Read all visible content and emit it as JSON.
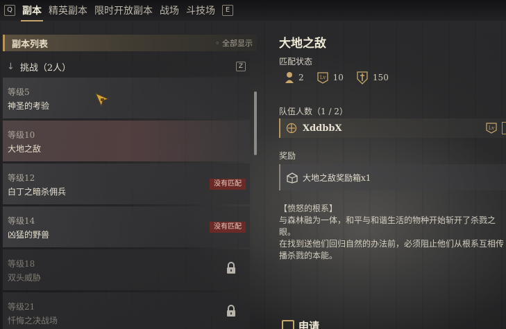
{
  "nav": {
    "left_key": "Q",
    "right_key": "E",
    "tabs": [
      {
        "label": "副本",
        "active": true
      },
      {
        "label": "精英副本",
        "active": false
      },
      {
        "label": "限时开放副本",
        "active": false
      },
      {
        "label": "战场",
        "active": false
      },
      {
        "label": "斗技场",
        "active": false
      }
    ]
  },
  "list": {
    "title": "副本列表",
    "show_all": "◦ 全部显示",
    "group": {
      "label": "挑战（2人）",
      "key": "Z"
    },
    "items": [
      {
        "level": "等级5",
        "name": "神圣的考验",
        "badge": "",
        "locked": false,
        "selected": false
      },
      {
        "level": "等级10",
        "name": "大地之敌",
        "badge": "",
        "locked": false,
        "selected": true
      },
      {
        "level": "等级12",
        "name": "白丁之暗杀佣兵",
        "badge": "没有匹配",
        "locked": false,
        "selected": false
      },
      {
        "level": "等级14",
        "name": "凶猛的野兽",
        "badge": "没有匹配",
        "locked": false,
        "selected": false
      },
      {
        "level": "等级18",
        "name": "双头威胁",
        "badge": "",
        "locked": true,
        "selected": false
      },
      {
        "level": "等级21",
        "name": "忏悔之决战场",
        "badge": "",
        "locked": true,
        "selected": false
      }
    ]
  },
  "detail": {
    "title": "大地之敌",
    "match_label": "匹配状态",
    "stats": {
      "players": "2",
      "level": "10",
      "power": "150"
    },
    "team_label": "队伍人数（1 / 2）",
    "member": "XddbbX",
    "reward_label": "奖励",
    "reward_item": "大地之敌奖励箱x1",
    "desc_title": "【愤怒的根系】",
    "desc_lines": [
      "与森林融为一体，和平与和谐生活的物种开始斩开了杀戮之",
      "眼。",
      "在找到送他们回归自然的办法前，必须阻止他们从根系互相传",
      "播杀戮的本能。"
    ],
    "apply_label": "申请"
  },
  "colors": {
    "accent": "#c8a86a",
    "badge": "#6a2a26"
  }
}
